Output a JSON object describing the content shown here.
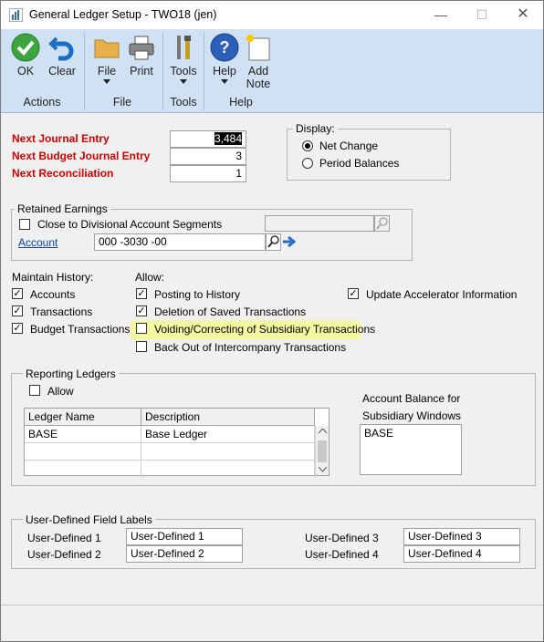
{
  "window": {
    "title": "General Ledger Setup  -  TWO18 (jen)"
  },
  "ribbon": {
    "ok": "OK",
    "clear": "Clear",
    "file": "File",
    "print": "Print",
    "tools": "Tools",
    "help": "Help",
    "add_note": "Add\nNote",
    "groups": {
      "actions": "Actions",
      "file": "File",
      "tools": "Tools",
      "help": "Help"
    }
  },
  "numbers": {
    "next_journal_label": "Next Journal Entry",
    "next_journal_value": "3,484",
    "next_budget_label": "Next Budget Journal Entry",
    "next_budget_value": "3",
    "next_recon_label": "Next Reconciliation",
    "next_recon_value": "1"
  },
  "display": {
    "caption": "Display:",
    "net_change": "Net Change",
    "period_balances": "Period Balances",
    "selected": "Net Change"
  },
  "retained": {
    "caption": "Retained Earnings",
    "close_label": "Close to Divisional Account Segments",
    "close_checked": false,
    "account_link": "Account",
    "account_value": "000 -3030 -00"
  },
  "history": {
    "caption": "Maintain History:",
    "accounts": "Accounts",
    "transactions": "Transactions",
    "budget": "Budget Transactions",
    "accounts_checked": true,
    "transactions_checked": true,
    "budget_checked": true
  },
  "allow": {
    "caption": "Allow:",
    "posting": "Posting to History",
    "deletion": "Deletion of Saved Transactions",
    "voiding": "Voiding/Correcting of Subsidiary Transactions",
    "backout": "Back Out of Intercompany Transactions",
    "update_accel": "Update Accelerator Information",
    "posting_checked": true,
    "deletion_checked": true,
    "voiding_checked": false,
    "backout_checked": false,
    "update_accel_checked": true,
    "highlight_color": "#f4f8a0"
  },
  "reporting": {
    "caption": "Reporting Ledgers",
    "allow": "Allow",
    "allow_checked": false,
    "col_ledger": "Ledger Name",
    "col_desc": "Description",
    "rows": [
      {
        "name": "BASE",
        "desc": "Base Ledger"
      }
    ],
    "balance_caption_1": "Account Balance for",
    "balance_caption_2": "Subsidiary Windows",
    "balance_value": "BASE"
  },
  "udf": {
    "caption": "User-Defined Field Labels",
    "l1": "User-Defined 1",
    "v1": "User-Defined 1",
    "l2": "User-Defined 2",
    "v2": "User-Defined 2",
    "l3": "User-Defined 3",
    "v3": "User-Defined 3",
    "l4": "User-Defined 4",
    "v4": "User-Defined 4"
  }
}
